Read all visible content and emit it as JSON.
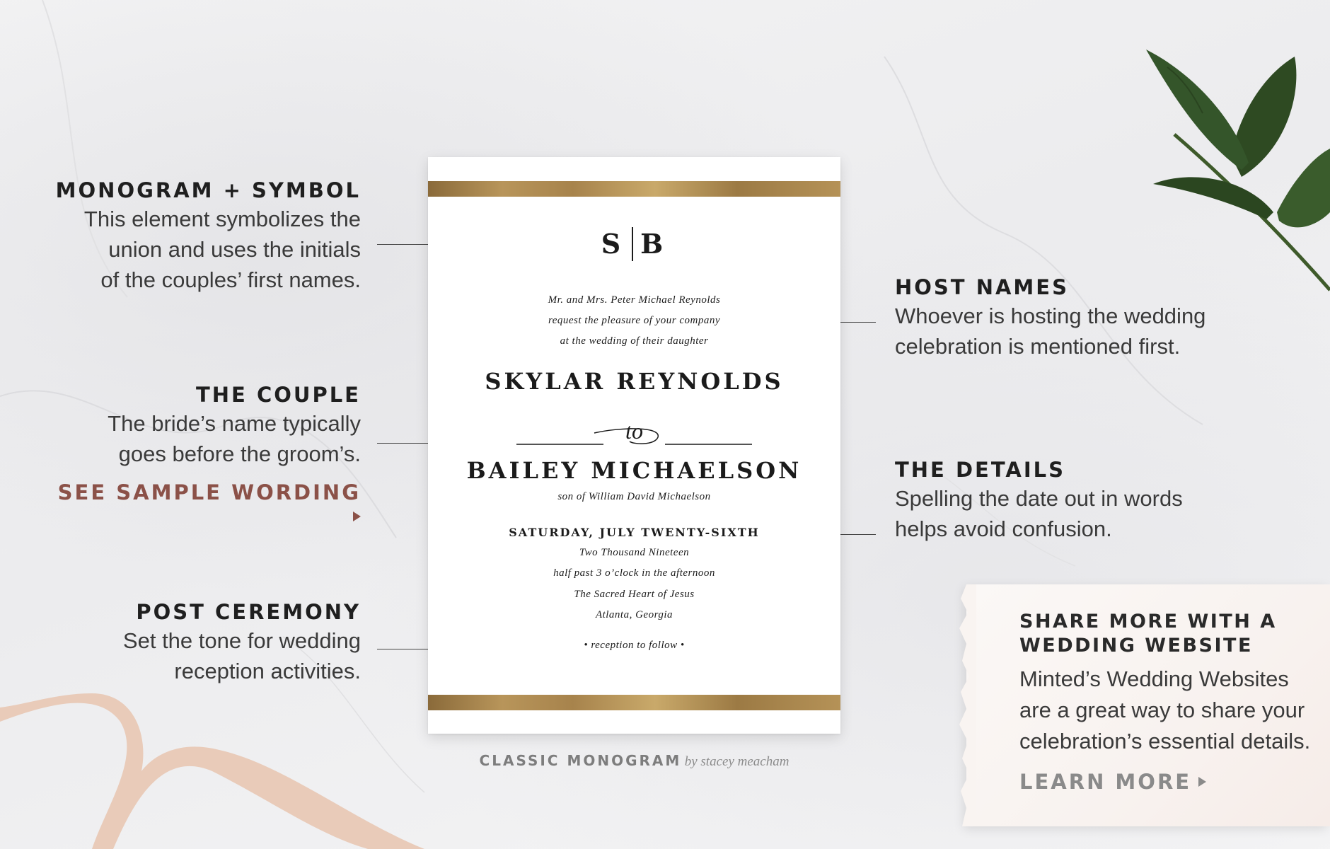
{
  "annotations": {
    "monogram": {
      "title": "MONOGRAM + SYMBOL",
      "lines": [
        "This element symbolizes the",
        "union and uses the initials",
        "of the couples’ first names."
      ]
    },
    "couple": {
      "title": "THE COUPLE",
      "lines": [
        "The bride’s name typically",
        "goes before the groom’s."
      ],
      "link": "SEE SAMPLE WORDING"
    },
    "post_ceremony": {
      "title": "POST CEREMONY",
      "lines": [
        "Set the tone for wedding",
        "reception activities."
      ]
    },
    "host_names": {
      "title": "HOST NAMES",
      "lines": [
        "Whoever is hosting the wedding",
        "celebration is mentioned first."
      ]
    },
    "details": {
      "title": "THE DETAILS",
      "lines": [
        "Spelling the date out in words",
        "helps avoid confusion."
      ]
    }
  },
  "invitation": {
    "monogram_left": "S",
    "monogram_right": "B",
    "hosts": [
      "Mr. and Mrs. Peter Michael Reynolds",
      "request the pleasure of your company",
      "at the wedding of their daughter"
    ],
    "bride": "SKYLAR REYNOLDS",
    "connector": "to",
    "groom": "BAILEY MICHAELSON",
    "groom_parent": "son of William David Michaelson",
    "date": "SATURDAY, JULY TWENTY-SIXTH",
    "details": [
      "Two Thousand Nineteen",
      "half past 3 o’clock in the afternoon",
      "The Sacred Heart of Jesus",
      "Atlanta, Georgia"
    ],
    "reception": "• reception to follow •",
    "foil_color": "#b8955a"
  },
  "credit": {
    "design": "CLASSIC MONOGRAM",
    "byline": "by stacey meacham"
  },
  "promo": {
    "title_lines": [
      "SHARE MORE WITH A",
      "WEDDING WEBSITE"
    ],
    "lines": [
      "Minted’s Wedding Websites",
      "are a great way to share your",
      "celebration’s essential details."
    ],
    "link": "LEARN MORE"
  },
  "colors": {
    "accent_link": "#8b5148",
    "muted_link": "#8a8a8a",
    "text": "#2b2b2b"
  },
  "decor": {
    "top_right": "leaf-sprig-icon",
    "bottom_left": "ribbon-icon",
    "link_arrow": "triangle-right-icon"
  }
}
